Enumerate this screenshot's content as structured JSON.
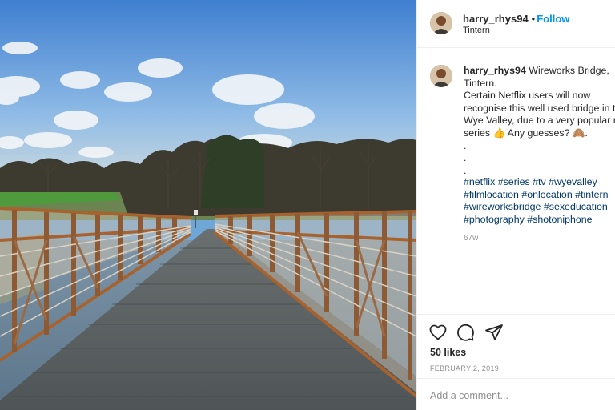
{
  "post": {
    "username": "harry_rhys94",
    "follow_label": "Follow",
    "separator": "•",
    "location": "Tintern"
  },
  "caption": {
    "username": "harry_rhys94",
    "lines": [
      "Wireworks Bridge,",
      "Tintern.",
      "Certain Netflix users will now",
      "recognise this well used bridge in t",
      "Wye Valley, due to a very popular n",
      "series 👍 Any guesses? 🙈.",
      ".",
      ".",
      "."
    ],
    "hashtag_lines": [
      [
        "#netflix",
        "#series",
        "#tv",
        "#wyevalley"
      ],
      [
        "#filmlocation",
        "#onlocation",
        "#tintern"
      ],
      [
        "#wireworksbridge",
        "#sexeducation"
      ],
      [
        "#photography",
        "#shotoniphone"
      ]
    ],
    "age": "67w"
  },
  "actions": {
    "likes": "50 likes",
    "date": "FEBRUARY 2, 2019",
    "icons": [
      "heart-icon",
      "comment-icon",
      "share-icon"
    ]
  },
  "comment_box": {
    "placeholder": "Add a comment..."
  },
  "colors": {
    "link_blue": "#0095f6",
    "hashtag": "#00376b",
    "muted": "#8e8e8e",
    "border": "#efefef"
  }
}
